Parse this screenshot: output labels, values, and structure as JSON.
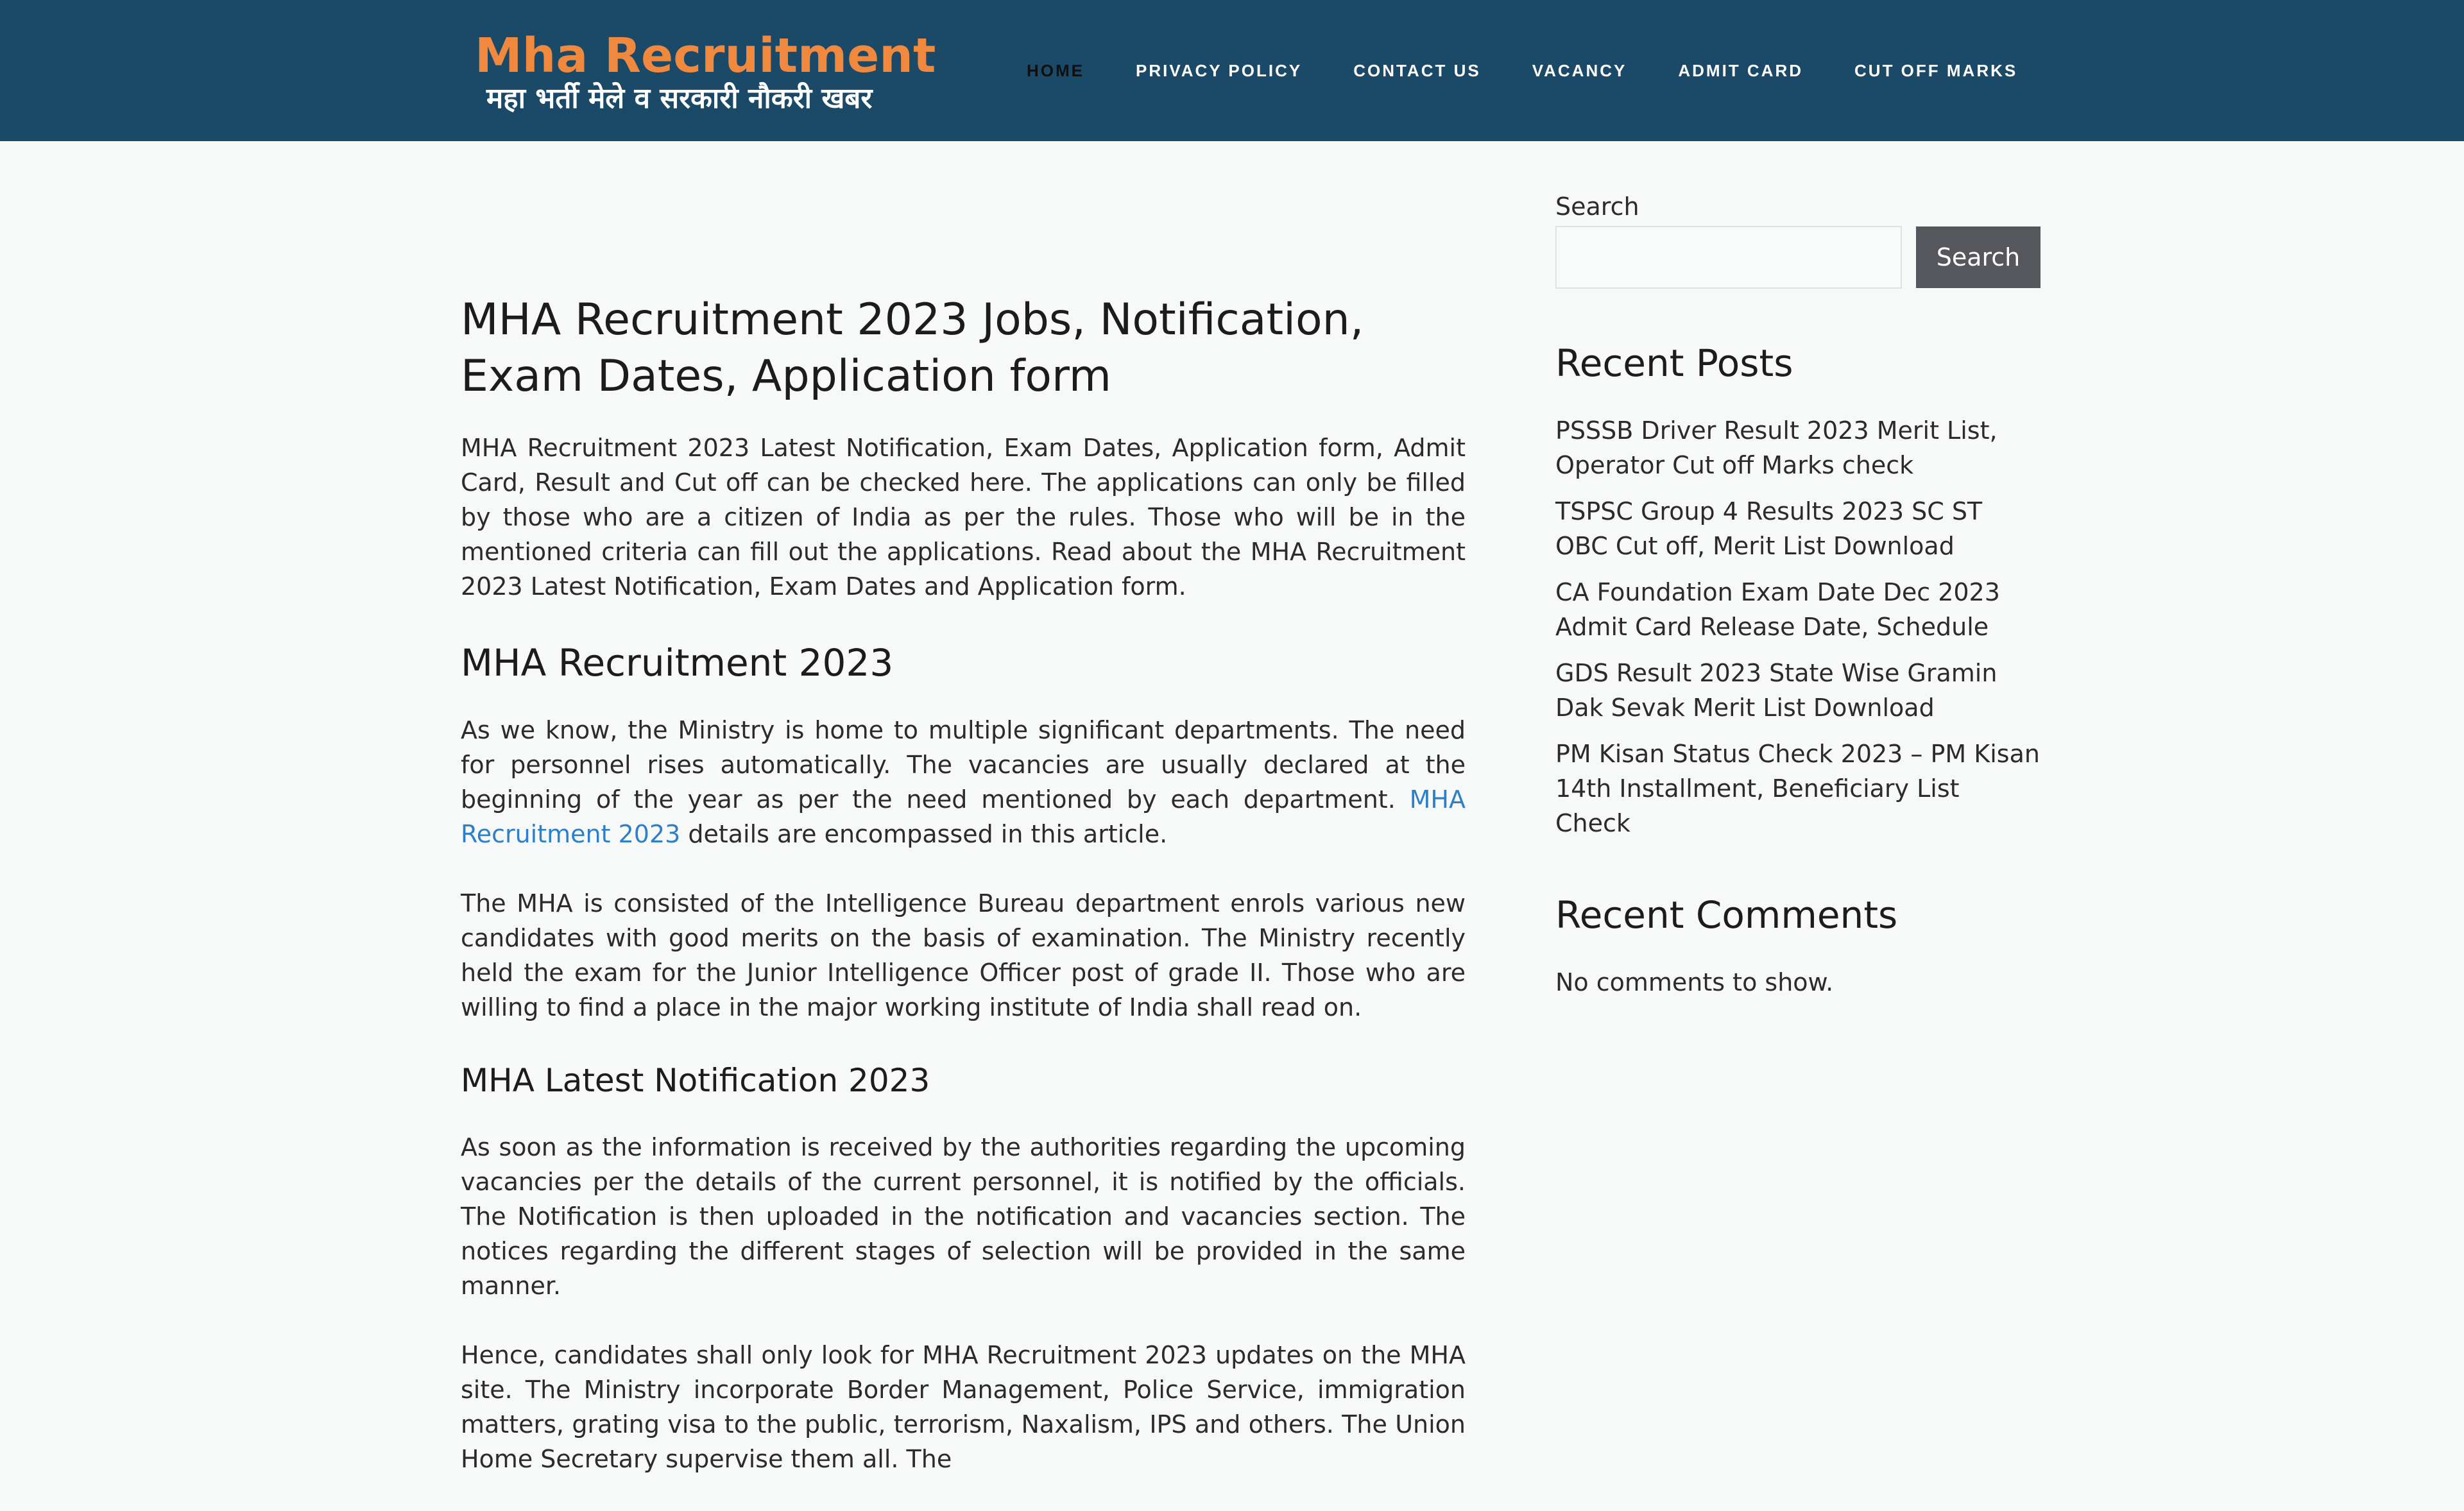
{
  "header": {
    "logo_title": "Mha Recruitment",
    "logo_subtitle": "महा भर्ती मेले व सरकारी नौकरी खबर",
    "nav": [
      {
        "label": "HOME"
      },
      {
        "label": "PRIVACY POLICY"
      },
      {
        "label": "CONTACT US"
      },
      {
        "label": "VACANCY"
      },
      {
        "label": "ADMIT CARD"
      },
      {
        "label": "CUT OFF MARKS"
      }
    ]
  },
  "colors": {
    "header_bg": "#1b4a68",
    "logo_orange": "#f0883e",
    "link_blue": "#2d7fc9",
    "button_bg": "#55575d",
    "page_bg": "#f7f9f9"
  },
  "article": {
    "title": "MHA Recruitment 2023 Jobs, Notification, Exam Dates, Application form",
    "intro": "MHA Recruitment 2023 Latest Notification, Exam Dates, Application form, Admit Card, Result and Cut off can be checked here. The applications can only be filled by those who are a citizen of India as per the rules. Those who will be in the mentioned criteria can fill out the applications. Read about the MHA Recruitment 2023 Latest Notification, Exam Dates and Application form.",
    "h2": "MHA Recruitment 2023",
    "p1_before": "As we know, the Ministry is home to multiple significant departments. The need for personnel rises automatically. The vacancies are usually declared at the beginning of the year as per the need mentioned by each department. ",
    "p1_link": "MHA Recruitment 2023",
    "p1_after": " details are encompassed in this article.",
    "p2": "The MHA is consisted of the Intelligence Bureau department enrols various new candidates with good merits on the basis of examination. The Ministry recently held the exam for the Junior Intelligence Officer post of grade II. Those who are willing to find a place in the major working institute of India shall read on.",
    "h3": "MHA Latest Notification 2023",
    "p3": "As soon as the information is received by the authorities regarding the upcoming vacancies per the details of the current personnel, it is notified by the officials. The Notification is then uploaded in the notification and vacancies section. The notices regarding the different stages of selection will be provided in the same manner.",
    "p4": "Hence, candidates shall only look for MHA Recruitment 2023 updates on the MHA site. The Ministry incorporate Border Management, Police Service, immigration matters, grating visa to the public, terrorism, Naxalism, IPS and others. The Union Home Secretary supervise them all. The"
  },
  "sidebar": {
    "search_label": "Search",
    "search_button": "Search",
    "recent_posts_title": "Recent Posts",
    "recent_posts": [
      "PSSSB Driver Result 2023 Merit List, Operator Cut off Marks check",
      "TSPSC Group 4 Results 2023 SC ST OBC Cut off, Merit List Download",
      "CA Foundation Exam Date Dec 2023 Admit Card Release Date, Schedule",
      "GDS Result 2023 State Wise Gramin Dak Sevak Merit List Download",
      "PM Kisan Status Check 2023 – PM Kisan 14th Installment, Beneficiary List Check"
    ],
    "recent_comments_title": "Recent Comments",
    "no_comments": "No comments to show."
  }
}
